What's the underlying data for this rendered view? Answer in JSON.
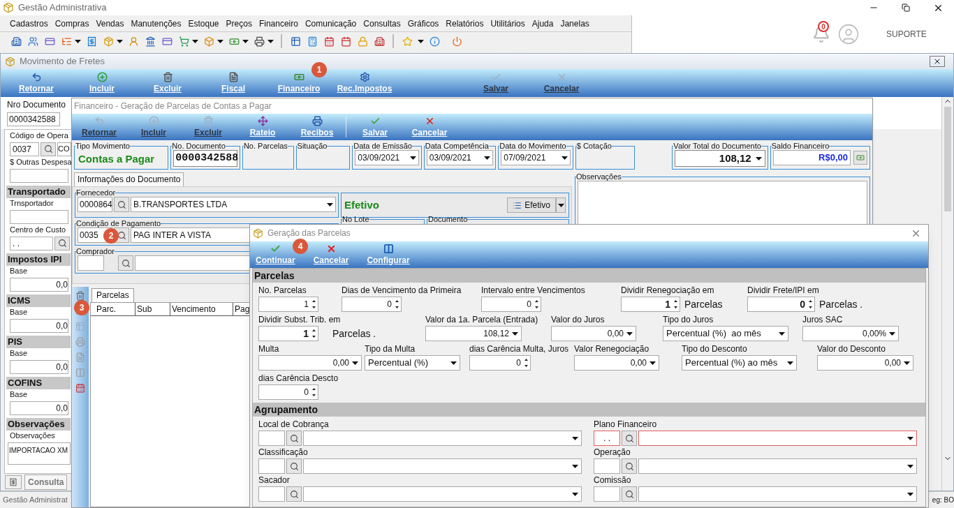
{
  "app": {
    "title": "Gestão Administrativa",
    "menu": [
      "Cadastros",
      "Compras",
      "Vendas",
      "Manutenções",
      "Estoque",
      "Preços",
      "Financeiro",
      "Comunicação",
      "Consultas",
      "Gráficos",
      "Relatórios",
      "Utilitários",
      "Ajuda",
      "Janelas"
    ],
    "notification_count": "0",
    "user": "SUPORTE",
    "status_left": "Gestão Administrat",
    "status_right": "eg: BO"
  },
  "main_window": {
    "title": "Movimento de Fretes",
    "toolbar": [
      {
        "label": "Retornar",
        "disabled": false
      },
      {
        "label": "Incluir",
        "disabled": false
      },
      {
        "label": "Excluir",
        "disabled": false
      },
      {
        "label": "Fiscal",
        "disabled": false
      },
      {
        "label": "Financeiro",
        "disabled": false
      },
      {
        "label": "Rec.Impostos",
        "disabled": false
      },
      {
        "label": "Salvar",
        "disabled": true
      },
      {
        "label": "Cancelar",
        "disabled": true
      }
    ],
    "doc_label": "Nro Documento",
    "doc_value": "0000342588",
    "left_panel": [
      {
        "kind": "label",
        "text": "Código de Opera"
      },
      {
        "kind": "lookup",
        "code": "0037",
        "name": "CO"
      },
      {
        "kind": "label",
        "text": "$ Outras Despesa"
      },
      {
        "kind": "blank"
      },
      {
        "kind": "section",
        "text": "Transportado"
      },
      {
        "kind": "label",
        "text": "Trnsportador"
      },
      {
        "kind": "blank"
      },
      {
        "kind": "label",
        "text": "Centro de Custo"
      },
      {
        "kind": "lookup",
        "code": ". ."
      },
      {
        "kind": "section",
        "text": "Impostos IPI"
      },
      {
        "kind": "label",
        "text": "Base"
      },
      {
        "kind": "value",
        "text": "0,0"
      },
      {
        "kind": "section",
        "text": "ICMS"
      },
      {
        "kind": "label",
        "text": "Base"
      },
      {
        "kind": "value",
        "text": "0,0"
      },
      {
        "kind": "section",
        "text": "PIS"
      },
      {
        "kind": "label",
        "text": "Base"
      },
      {
        "kind": "value",
        "text": "0,0"
      },
      {
        "kind": "section",
        "text": "COFINS"
      },
      {
        "kind": "label",
        "text": "Base"
      },
      {
        "kind": "value",
        "text": "0,0"
      },
      {
        "kind": "section",
        "text": "Observações"
      },
      {
        "kind": "label",
        "text": "Observações"
      },
      {
        "kind": "memo",
        "text": "IMPORTACAO XM"
      }
    ],
    "bottom_tab": "Consulta"
  },
  "fin_window": {
    "title": "Financeiro - Geração de Parcelas de Contas a Pagar",
    "toolbar": [
      {
        "label": "Retornar",
        "disabled": true
      },
      {
        "label": "Incluir",
        "disabled": true
      },
      {
        "label": "Excluir",
        "disabled": true
      },
      {
        "label": "Rateio",
        "disabled": false
      },
      {
        "label": "Recibos",
        "disabled": false
      },
      {
        "label": "Salvar",
        "disabled": false
      },
      {
        "label": "Cancelar",
        "disabled": false
      }
    ],
    "header_fields": [
      {
        "kind": "text",
        "label": "Tipo Movimento",
        "value": "Contas a Pagar"
      },
      {
        "kind": "field",
        "label": "No. Documento",
        "value": "0000342588"
      },
      {
        "kind": "empty",
        "label": "No. Parcelas"
      },
      {
        "kind": "empty",
        "label": "Situação"
      },
      {
        "kind": "date",
        "label": "Data de Emissão",
        "value": "03/09/2021"
      },
      {
        "kind": "date",
        "label": "Data Competência",
        "value": "03/09/2021"
      },
      {
        "kind": "date",
        "label": "Data do Movimento",
        "value": "07/09/2021"
      },
      {
        "kind": "empty",
        "label": "$ Cotação"
      },
      {
        "kind": "combo",
        "label": "Valor Total do Documento",
        "value": "108,12"
      },
      {
        "kind": "balance",
        "label": "Saldo Financeiro",
        "value": "R$0,00"
      }
    ],
    "tab": "Informações do Documento",
    "fornecedor": {
      "label": "Fornecedor",
      "code": "0000864",
      "name": "B.TRANSPORTES LTDA"
    },
    "status": {
      "text": "Efetivo",
      "button": "Efetivo"
    },
    "condicao": {
      "label": "Condição de Pagamento",
      "code": "0035",
      "name": "PAG INTER A VISTA"
    },
    "lote_label": "No Lote",
    "documento_label": "Documento",
    "comprador_label": "Comprador",
    "observacoes_label": "Observações",
    "grid_tab": "Parcelas",
    "grid_columns": [
      "Parc.",
      "Sub",
      "Vencimento",
      "Pag"
    ]
  },
  "dialog": {
    "title": "Geração das Parcelas",
    "toolbar": [
      "Continuar",
      "Cancelar",
      "Configurar"
    ],
    "parcelas": {
      "title": "Parcelas",
      "rows": [
        [
          {
            "label": "No. Parcelas",
            "kind": "spin",
            "value": "1"
          },
          {
            "label": "Dias de Vencimento da Primeira",
            "kind": "spin",
            "value": "0"
          },
          {
            "label": "Intervalo entre Vencimentos",
            "kind": "spin",
            "value": "0"
          },
          {
            "label": "Dividir Renegociação em",
            "kind": "spin",
            "value": "1",
            "bold": true,
            "suffix": "Parcelas"
          },
          {
            "label": "Dividir Frete/IPI em",
            "kind": "spin",
            "value": "0",
            "bold": true,
            "suffix": "Parcelas ."
          }
        ],
        [
          {
            "label": "Dividir Subst. Trib. em",
            "kind": "spin",
            "value": "1",
            "bold": true,
            "suffix": "Parcelas ."
          },
          {
            "label": "Valor da 1a. Parcela (Entrada)",
            "kind": "combo",
            "value": "108,12"
          },
          {
            "label": "Valor do Juros",
            "kind": "combo",
            "value": "0,00"
          },
          {
            "label": "Tipo do Juros",
            "kind": "select",
            "value": "Percentual (%)  ao mês"
          },
          {
            "label": "Juros SAC",
            "kind": "combo",
            "value": "0,00%"
          }
        ],
        [
          {
            "label": "Multa",
            "kind": "combo",
            "value": "0,00"
          },
          {
            "label": "Tipo da Multa",
            "kind": "select",
            "value": "Percentual (%)"
          },
          {
            "label": "dias Carência Multa, Juros",
            "kind": "spin",
            "value": "0"
          },
          {
            "label": "Valor Renegociação",
            "kind": "combo",
            "value": "0,00"
          },
          {
            "label": "Tipo do Desconto",
            "kind": "select",
            "value": "Percentual (%) ao mês"
          },
          {
            "label": "Valor do Desconto",
            "kind": "combo",
            "value": "0,00"
          }
        ],
        [
          {
            "label": "dias Carência Descto",
            "kind": "spin",
            "value": "0"
          }
        ]
      ]
    },
    "agrupamento": {
      "title": "Agrupamento",
      "rows": [
        [
          {
            "label": "Local de Cobrança",
            "invalid": false
          },
          {
            "label": "Plano Financeiro",
            "code": ". .",
            "invalid": true
          }
        ],
        [
          {
            "label": "Classificação",
            "invalid": false
          },
          {
            "label": "Operação",
            "invalid": false
          }
        ],
        [
          {
            "label": "Sacador",
            "invalid": false
          },
          {
            "label": "Comissão",
            "invalid": false
          }
        ]
      ]
    }
  },
  "markers": [
    "1",
    "2",
    "3",
    "4"
  ]
}
